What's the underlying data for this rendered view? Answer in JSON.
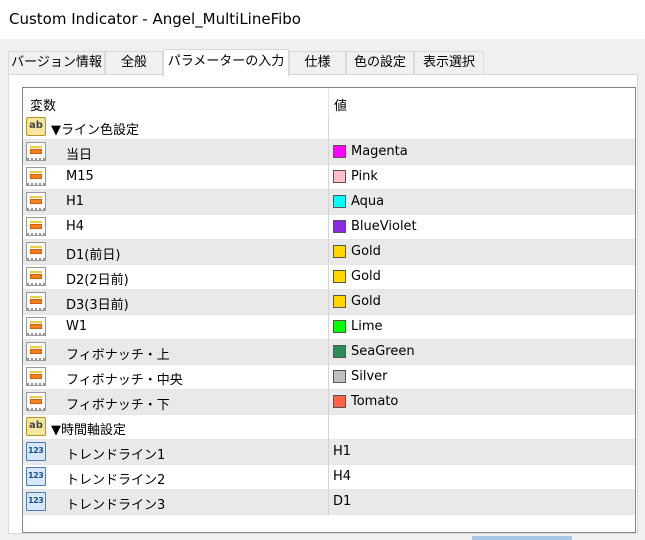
{
  "window": {
    "title": "Custom Indicator - Angel_MultiLineFibo"
  },
  "tabs": [
    {
      "label": "バージョン情報",
      "active": false
    },
    {
      "label": "全般",
      "active": false
    },
    {
      "label": "パラメーターの入力",
      "active": true
    },
    {
      "label": "仕様",
      "active": false
    },
    {
      "label": "色の設定",
      "active": false
    },
    {
      "label": "表示選択",
      "active": false
    }
  ],
  "grid": {
    "col_variable": "変数",
    "col_value": "値",
    "rows": [
      {
        "type": "group",
        "icon": "ab-icon",
        "name": "▼ライン色設定",
        "value": ""
      },
      {
        "type": "color",
        "icon": "color-param-icon",
        "name": "当日",
        "value": "Magenta",
        "color": "#ff00ff"
      },
      {
        "type": "color",
        "icon": "color-param-icon",
        "name": "M15",
        "value": "Pink",
        "color": "#ffc0cb"
      },
      {
        "type": "color",
        "icon": "color-param-icon",
        "name": "H1",
        "value": "Aqua",
        "color": "#00ffff"
      },
      {
        "type": "color",
        "icon": "color-param-icon",
        "name": "H4",
        "value": "BlueViolet",
        "color": "#8a2be2"
      },
      {
        "type": "color",
        "icon": "color-param-icon",
        "name": "D1(前日)",
        "value": "Gold",
        "color": "#ffd700"
      },
      {
        "type": "color",
        "icon": "color-param-icon",
        "name": "D2(2日前)",
        "value": "Gold",
        "color": "#ffd700"
      },
      {
        "type": "color",
        "icon": "color-param-icon",
        "name": "D3(3日前)",
        "value": "Gold",
        "color": "#ffd700"
      },
      {
        "type": "color",
        "icon": "color-param-icon",
        "name": "W1",
        "value": "Lime",
        "color": "#00ff00"
      },
      {
        "type": "color",
        "icon": "color-param-icon",
        "name": "フィボナッチ・上",
        "value": "SeaGreen",
        "color": "#2e8b57"
      },
      {
        "type": "color",
        "icon": "color-param-icon",
        "name": "フィボナッチ・中央",
        "value": "Silver",
        "color": "#c0c0c0"
      },
      {
        "type": "color",
        "icon": "color-param-icon",
        "name": "フィボナッチ・下",
        "value": "Tomato",
        "color": "#ff6347"
      },
      {
        "type": "group",
        "icon": "ab-icon",
        "name": "▼時間軸設定",
        "value": ""
      },
      {
        "type": "enum",
        "icon": "123-icon",
        "name": "トレンドライン1",
        "value": "H1"
      },
      {
        "type": "enum",
        "icon": "123-icon",
        "name": "トレンドライン2",
        "value": "H4"
      },
      {
        "type": "enum",
        "icon": "123-icon",
        "name": "トレンドライン3",
        "value": "D1"
      }
    ]
  }
}
